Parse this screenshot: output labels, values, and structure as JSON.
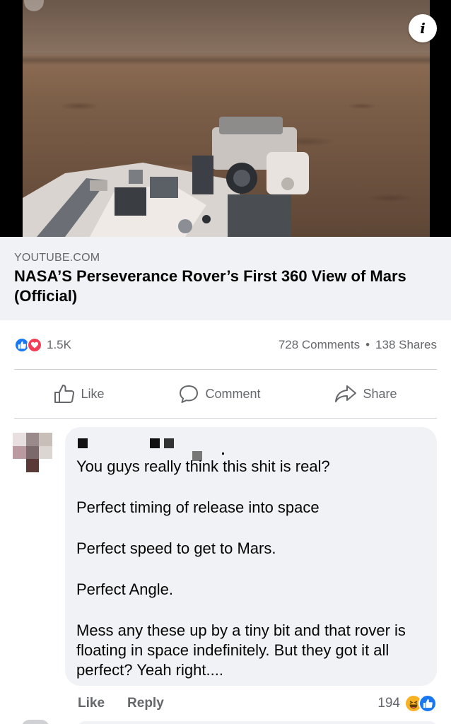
{
  "link_preview": {
    "domain": "YOUTUBE.COM",
    "title": "NASA’S Perseverance Rover’s First 360 View of Mars (Official)"
  },
  "media": {
    "info_icon": "info-icon",
    "info_label": "i"
  },
  "stats": {
    "reaction_count": "1.5K",
    "comments": "728 Comments",
    "separator": "•",
    "shares": "138 Shares",
    "reaction_icons": [
      "like-icon",
      "love-icon"
    ]
  },
  "actions": {
    "like": "Like",
    "comment": "Comment",
    "share": "Share"
  },
  "comment": {
    "lines": [
      "You guys really think this shit is real?",
      "Perfect timing of release into space",
      "Perfect speed to get to Mars.",
      "Perfect Angle.",
      "Mess any these up by a tiny bit and that rover is floating in space indefinitely. But they got it all perfect? Yeah right...."
    ],
    "footer": {
      "like": "Like",
      "reply": "Reply",
      "reaction_count": "194",
      "reaction_icons": [
        "haha-icon",
        "like-icon"
      ]
    }
  },
  "colors": {
    "facebook_blue": "#1877f2",
    "love_red": "#f33e58",
    "haha_yellow": "#f7b125",
    "secondary_text": "#65676b",
    "bubble_bg": "#f0f2f5"
  }
}
